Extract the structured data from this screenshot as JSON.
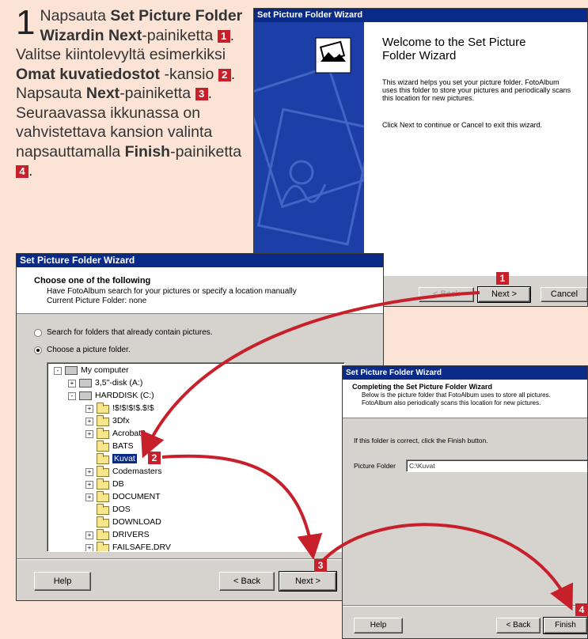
{
  "instructions": {
    "step": "1",
    "parts": [
      {
        "t": "Napsauta ",
        "b": false
      },
      {
        "t": "Set Picture Folder Wizardin Next",
        "b": true
      },
      {
        "t": "-painiketta ",
        "b": false
      },
      {
        "m": "1"
      },
      {
        "t": ". Valitse kiintolevyltä esimerkiksi ",
        "b": false
      },
      {
        "t": "Omat kuvatiedostot",
        "b": true
      },
      {
        "t": " -kansio ",
        "b": false
      },
      {
        "m": "2"
      },
      {
        "t": ". Napsauta ",
        "b": false
      },
      {
        "t": "Next",
        "b": true
      },
      {
        "t": "-painiketta ",
        "b": false
      },
      {
        "m": "3"
      },
      {
        "t": ". Seuraavassa ikkunassa on vahvistettava kansion valinta napsauttamalla ",
        "b": false
      },
      {
        "t": "Finish",
        "b": true
      },
      {
        "t": "-painiketta ",
        "b": false
      },
      {
        "m": "4"
      },
      {
        "t": ".",
        "b": false
      }
    ]
  },
  "welcome_window": {
    "title": "Set Picture Folder Wizard",
    "heading": "Welcome to the Set Picture Folder Wizard",
    "body": "This wizard helps you set your picture folder.  FotoAlbum uses this folder to store your pictures and periodically scans this location for new pictures.",
    "hint": "Click Next to continue or Cancel to exit this wizard.",
    "back_label": "< Back",
    "next_label": "Next >",
    "cancel_label": "Cancel"
  },
  "choose_window": {
    "title": "Set Picture Folder Wizard",
    "heading": "Choose one of the following",
    "sub1": "Have FotoAlbum search for your pictures or specify a location manually",
    "sub2": "Current Picture Folder: none",
    "radio_search": "Search for folders that already contain pictures.",
    "radio_choose": "Choose a picture folder.",
    "tree": [
      {
        "label": "My computer",
        "level": 0,
        "pm": "-",
        "icon": "computer"
      },
      {
        "label": "3,5\"-disk      (A:)",
        "level": 1,
        "pm": "+",
        "icon": "floppy"
      },
      {
        "label": "HARDDISK (C:)",
        "level": 1,
        "pm": "-",
        "icon": "drive"
      },
      {
        "label": "!$!$!$!$.$!$",
        "level": 2,
        "pm": "+",
        "icon": "folder"
      },
      {
        "label": "3Dfx",
        "level": 2,
        "pm": "+",
        "icon": "folder"
      },
      {
        "label": "Acrobat3",
        "level": 2,
        "pm": "+",
        "icon": "folder"
      },
      {
        "label": "BATS",
        "level": 2,
        "pm": "",
        "icon": "folder"
      },
      {
        "label": "Kuvat",
        "level": 2,
        "pm": "",
        "icon": "folder",
        "selected": true
      },
      {
        "label": "Codemasters",
        "level": 2,
        "pm": "+",
        "icon": "folder"
      },
      {
        "label": "DB",
        "level": 2,
        "pm": "+",
        "icon": "folder"
      },
      {
        "label": "DOCUMENT",
        "level": 2,
        "pm": "+",
        "icon": "folder"
      },
      {
        "label": "DOS",
        "level": 2,
        "pm": "",
        "icon": "folder"
      },
      {
        "label": "DOWNLOAD",
        "level": 2,
        "pm": "",
        "icon": "folder"
      },
      {
        "label": "DRIVERS",
        "level": 2,
        "pm": "+",
        "icon": "folder"
      },
      {
        "label": "FAILSAFE.DRV",
        "level": 2,
        "pm": "+",
        "icon": "folder"
      }
    ],
    "help_label": "Help",
    "back_label": "< Back",
    "next_label": "Next >"
  },
  "complete_window": {
    "title": "Set Picture Folder Wizard",
    "heading": "Completing the Set Picture Folder Wizard",
    "sub1": "Below is the picture folder that FotoAlbum uses to store all pictures.",
    "sub2": "FotoAlbum also periodically scans this location for new pictures.",
    "hint": "If this folder is correct, click the Finish button.",
    "folder_label": "Picture Folder",
    "folder_value": "C:\\Kuvat",
    "help_label": "Help",
    "back_label": "< Back",
    "finish_label": "Finish"
  },
  "markers": [
    "1",
    "2",
    "3",
    "4"
  ],
  "colors": {
    "background": "#fbe3d5",
    "titlebar": "#0a2a87",
    "marker": "#c8202a",
    "arrow": "#c8202a"
  }
}
